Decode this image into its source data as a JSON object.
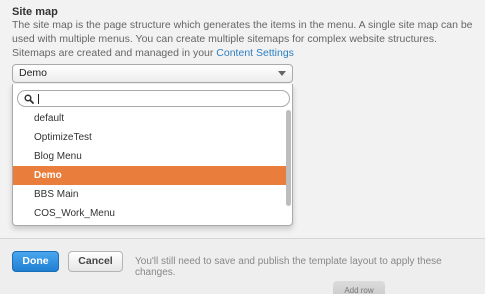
{
  "section": {
    "title": "Site map",
    "description": "The site map is the page structure which generates the items in the menu. A single site map can be used with multiple menus. You can create multiple sitemaps for complex website structures. Sitemaps are created and managed in your",
    "link_text": "Content Settings"
  },
  "select": {
    "value": "Demo"
  },
  "dropdown": {
    "search_value": "",
    "options": [
      "default",
      "OptimizeTest",
      "Blog Menu",
      "Demo",
      "BBS Main",
      "COS_Work_Menu"
    ],
    "selected": "Demo",
    "accent_color": "#e97d3b"
  },
  "footer": {
    "done_label": "Done",
    "cancel_label": "Cancel",
    "note": "You'll still need to save and publish the template layout to apply these changes.",
    "background_button_label": "Add row"
  },
  "colors": {
    "primary_button": "#2a8ae0",
    "link": "#2d7fc1"
  }
}
